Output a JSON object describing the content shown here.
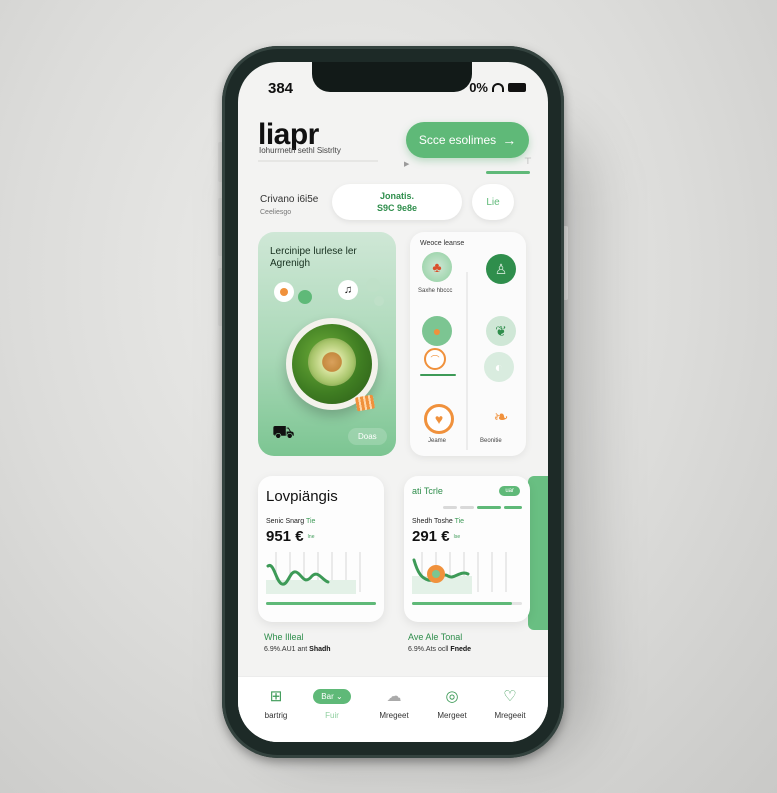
{
  "status": {
    "time": "384",
    "battery": "0%"
  },
  "header": {
    "title": "liapr",
    "subtitle": "Iohurrnetn sethl Sistrlty",
    "cta_label": "Scce esolimes"
  },
  "filter": {
    "label": "Crivano i6i5e",
    "sublabel": "Ceeliesgo",
    "pill_line1": "Jonatis.",
    "pill_line2": "S9C 9e8e",
    "small_pill": "Lie"
  },
  "feature_card": {
    "title": "Lercinipe lurlese ler Agrenigh",
    "button_label": "Doas"
  },
  "grid_card": {
    "title": "Weoce leanse",
    "items": [
      {
        "label": "Saxhe hbccc",
        "icon": "salad-icon"
      },
      {
        "label": "",
        "icon": "pear-icon"
      },
      {
        "label": "",
        "icon": "fruit-icon"
      },
      {
        "label": "",
        "icon": "leaf-icon"
      },
      {
        "label": "",
        "icon": "chef-icon"
      },
      {
        "label": "",
        "icon": "bowl-icon"
      },
      {
        "label": "Jeame",
        "icon": "heart-icon"
      },
      {
        "label": "Beonitie",
        "icon": "orange-leaf-icon"
      }
    ]
  },
  "chart_left": {
    "title": "Lovpiängis",
    "subtitle_a": "Senic Snarg",
    "subtitle_b": "Tie",
    "value": "951 €",
    "value_note": "Ine",
    "caption": "Whe Illeal",
    "caption_sub_a": "6.9%.AU1 ant",
    "caption_sub_b": "Shadh"
  },
  "chart_right": {
    "title": "ati Tcrle",
    "badge": "uar",
    "subtitle_a": "Shedh Toshe",
    "subtitle_b": "Tie",
    "value": "291 €",
    "value_note": "Ise",
    "caption": "Ave Ale Tonal",
    "caption_sub_a": "6.9%.Ats ocll",
    "caption_sub_b": "Fnede"
  },
  "nav": [
    {
      "label": "bartrig",
      "icon": "grid-bars-icon"
    },
    {
      "label": "Fuir",
      "pill": "Bar",
      "icon": "chevron-down-icon"
    },
    {
      "label": "Mregeet",
      "icon": "cloud-icon"
    },
    {
      "label": "Mergeet",
      "icon": "compass-icon"
    },
    {
      "label": "Mregeeit",
      "icon": "heart-outline-icon"
    }
  ],
  "colors": {
    "accent": "#5fb978",
    "accent_dark": "#2f8e4c",
    "frame": "#1d2a27",
    "orange": "#f0913c"
  }
}
